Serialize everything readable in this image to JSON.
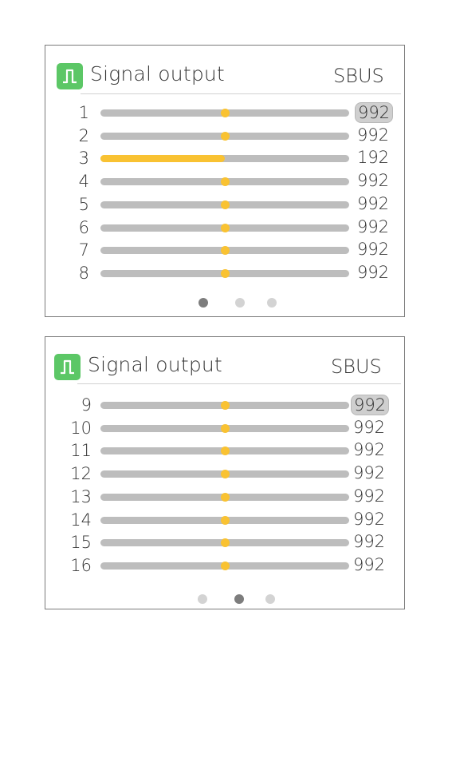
{
  "colors": {
    "accent": "#f9c232",
    "logo": "#5cc766",
    "track": "#bdbdbd",
    "dot_active": "#7d7d7d",
    "dot_inactive": "#d3d3d3"
  },
  "panels": [
    {
      "title": "Signal output",
      "protocol": "SBUS",
      "active_page": 0,
      "page_count": 3,
      "channels": [
        {
          "label": "1",
          "value": "992",
          "level": 0.5,
          "selected": true
        },
        {
          "label": "2",
          "value": "992",
          "level": 0.5
        },
        {
          "label": "3",
          "value": "192",
          "level": 0.0,
          "fill": 0.5
        },
        {
          "label": "4",
          "value": "992",
          "level": 0.5
        },
        {
          "label": "5",
          "value": "992",
          "level": 0.5
        },
        {
          "label": "6",
          "value": "992",
          "level": 0.5
        },
        {
          "label": "7",
          "value": "992",
          "level": 0.5
        },
        {
          "label": "8",
          "value": "992",
          "level": 0.5
        }
      ]
    },
    {
      "title": "Signal output",
      "protocol": "SBUS",
      "active_page": 1,
      "page_count": 3,
      "channels": [
        {
          "label": "9",
          "value": "992",
          "level": 0.5,
          "selected": true
        },
        {
          "label": "10",
          "value": "992",
          "level": 0.5
        },
        {
          "label": "11",
          "value": "992",
          "level": 0.5
        },
        {
          "label": "12",
          "value": "992",
          "level": 0.5
        },
        {
          "label": "13",
          "value": "992",
          "level": 0.5
        },
        {
          "label": "14",
          "value": "992",
          "level": 0.5
        },
        {
          "label": "15",
          "value": "992",
          "level": 0.5
        },
        {
          "label": "16",
          "value": "992",
          "level": 0.5
        }
      ]
    }
  ]
}
